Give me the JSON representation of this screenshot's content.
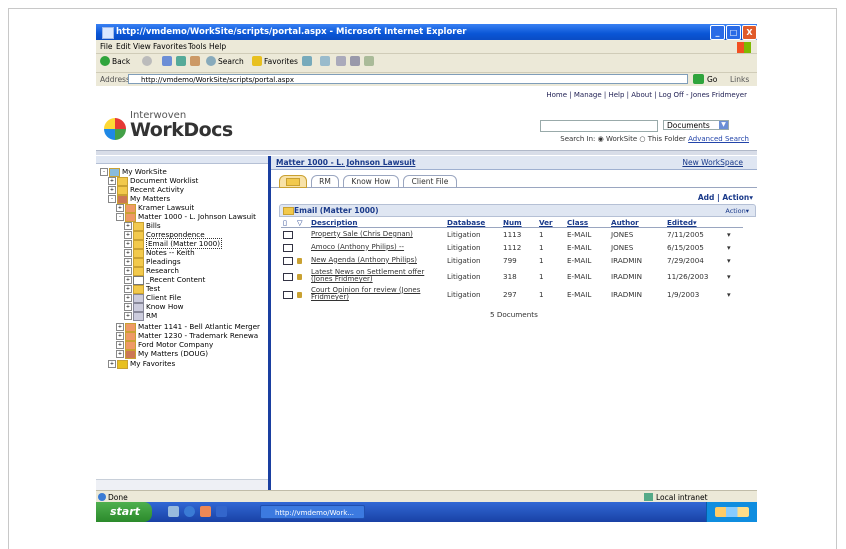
{
  "window": {
    "title": "http://vmdemo/WorkSite/scripts/portal.aspx - Microsoft Internet Explorer",
    "min": "_",
    "max": "□",
    "close": "X"
  },
  "menu": [
    "File",
    "Edit",
    "View",
    "Favorites",
    "Tools",
    "Help"
  ],
  "toolbar": {
    "back": "Back",
    "search": "Search",
    "favorites": "Favorites"
  },
  "address": {
    "label": "Address",
    "url": "http://vmdemo/WorkSite/scripts/portal.aspx",
    "go": "Go",
    "links": "Links"
  },
  "topnav": "Home | Manage | Help | About | Log Off - Jones Fridmeyer",
  "logo": {
    "small": "Interwoven",
    "big": "WorkDocs"
  },
  "search": {
    "scope_select": "Documents",
    "search_in": "Search In:",
    "opt_worksite": "WorkSite",
    "opt_folder": "This Folder",
    "advanced": "Advanced Search"
  },
  "tree": [
    {
      "label": "My WorkSite"
    },
    {
      "label": "Document Worklist"
    },
    {
      "label": "Recent Activity"
    },
    {
      "label": "My Matters"
    },
    {
      "label": "Kramer Lawsuit"
    },
    {
      "label": "Matter 1000 - L. Johnson Lawsuit"
    },
    {
      "label": "Bills"
    },
    {
      "label": "Correspondence"
    },
    {
      "label": "Email (Matter 1000)"
    },
    {
      "label": "Notes -- Keith"
    },
    {
      "label": "Pleadings"
    },
    {
      "label": "Research"
    },
    {
      "label": "_Recent Content"
    },
    {
      "label": "Test"
    },
    {
      "label": "Client File"
    },
    {
      "label": "Know How"
    },
    {
      "label": "RM"
    },
    {
      "label": "Matter 1141 - Bell Atlantic Merger"
    },
    {
      "label": "Matter 1230 - Trademark Renewa"
    },
    {
      "label": "Ford Motor Company"
    },
    {
      "label": "My Matters (DOUG)"
    },
    {
      "label": "My Favorites"
    }
  ],
  "matter": {
    "title": "Matter 1000 - L. Johnson Lawsuit",
    "new_workspace": "New WorkSpace"
  },
  "tabs": [
    "RM",
    "Know How",
    "Client File"
  ],
  "add_action": "Add | Action",
  "email_folder": {
    "title": "Email (Matter 1000)",
    "action": "Action"
  },
  "columns": [
    "Description",
    "Database",
    "Num",
    "Ver",
    "Class",
    "Author",
    "Edited"
  ],
  "rows": [
    {
      "desc": "Property Sale (Chris Degnan)",
      "db": "Litigation",
      "num": "1113",
      "ver": "1",
      "cls": "E-MAIL",
      "author": "JONES",
      "edited": "7/11/2005"
    },
    {
      "desc": "Amoco (Anthony Philips) --",
      "db": "Litigation",
      "num": "1112",
      "ver": "1",
      "cls": "E-MAIL",
      "author": "JONES",
      "edited": "6/15/2005"
    },
    {
      "desc": "New Agenda (Anthony Philips)",
      "db": "Litigation",
      "num": "799",
      "ver": "1",
      "cls": "E-MAIL",
      "author": "IRADMIN",
      "edited": "7/29/2004"
    },
    {
      "desc": "Latest News on Settlement offer (Jones Fridmeyer)",
      "db": "Litigation",
      "num": "318",
      "ver": "1",
      "cls": "E-MAIL",
      "author": "IRADMIN",
      "edited": "11/26/2003"
    },
    {
      "desc": "Court Opinion for review (Jones Fridmeyer)",
      "db": "Litigation",
      "num": "297",
      "ver": "1",
      "cls": "E-MAIL",
      "author": "IRADMIN",
      "edited": "1/9/2003"
    }
  ],
  "summary": "5 Documents",
  "status": {
    "left": "Done",
    "zone": "Local intranet"
  },
  "taskbar": {
    "start": "start",
    "task": "http://vmdemo/Work..."
  }
}
